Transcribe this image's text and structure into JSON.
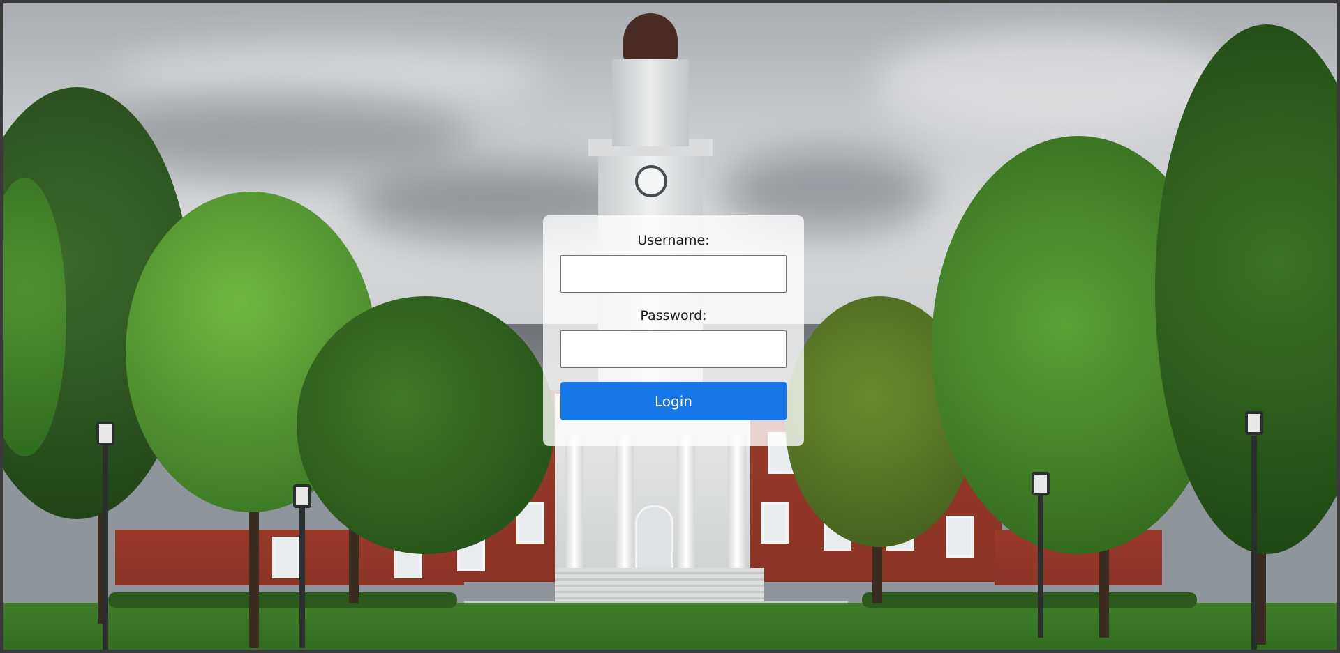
{
  "login": {
    "username_label": "Username:",
    "username_value": "",
    "password_label": "Password:",
    "password_value": "",
    "login_button_label": "Login"
  },
  "background": {
    "icon": "campus-clock-tower-photo"
  },
  "colors": {
    "accent": "#1877e8",
    "panel_background": "#ffffffc7"
  }
}
